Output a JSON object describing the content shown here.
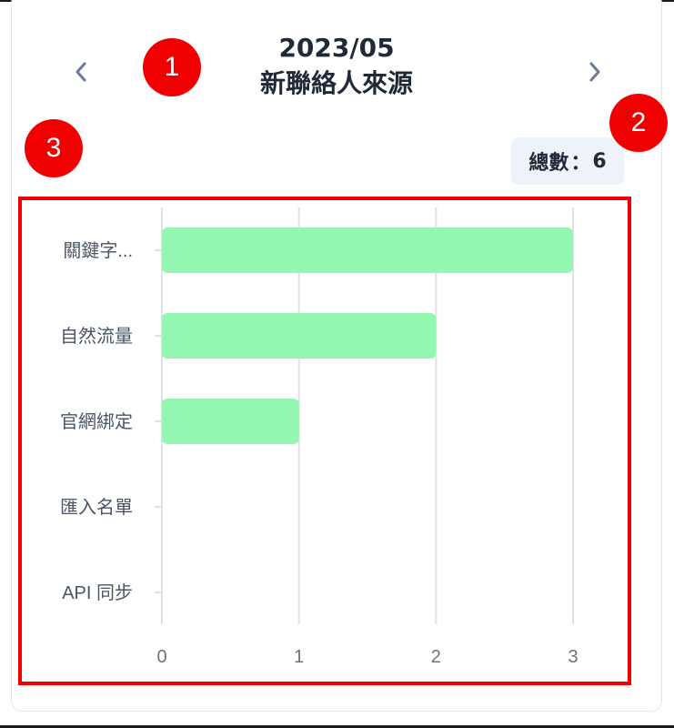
{
  "header": {
    "month": "2023/05",
    "title": "新聯絡人來源",
    "prev_icon": "chevron-left-icon",
    "next_icon": "chevron-right-icon"
  },
  "total": {
    "label": "總數",
    "separator": "：",
    "value": "6"
  },
  "markers": [
    "1",
    "2",
    "3"
  ],
  "colors": {
    "bar": "#94f7b0",
    "grid": "#dde1ea",
    "highlight": "#f00000",
    "marker_text": "#ffffff"
  },
  "chart_data": {
    "type": "bar",
    "orientation": "horizontal",
    "categories": [
      "關鍵字...",
      "自然流量",
      "官網綁定",
      "匯入名單",
      "API 同步"
    ],
    "values": [
      3,
      2,
      1,
      0,
      0
    ],
    "xlim": [
      0,
      3
    ],
    "xticks": [
      0,
      1,
      2,
      3
    ],
    "grid": true,
    "legend": "none"
  }
}
